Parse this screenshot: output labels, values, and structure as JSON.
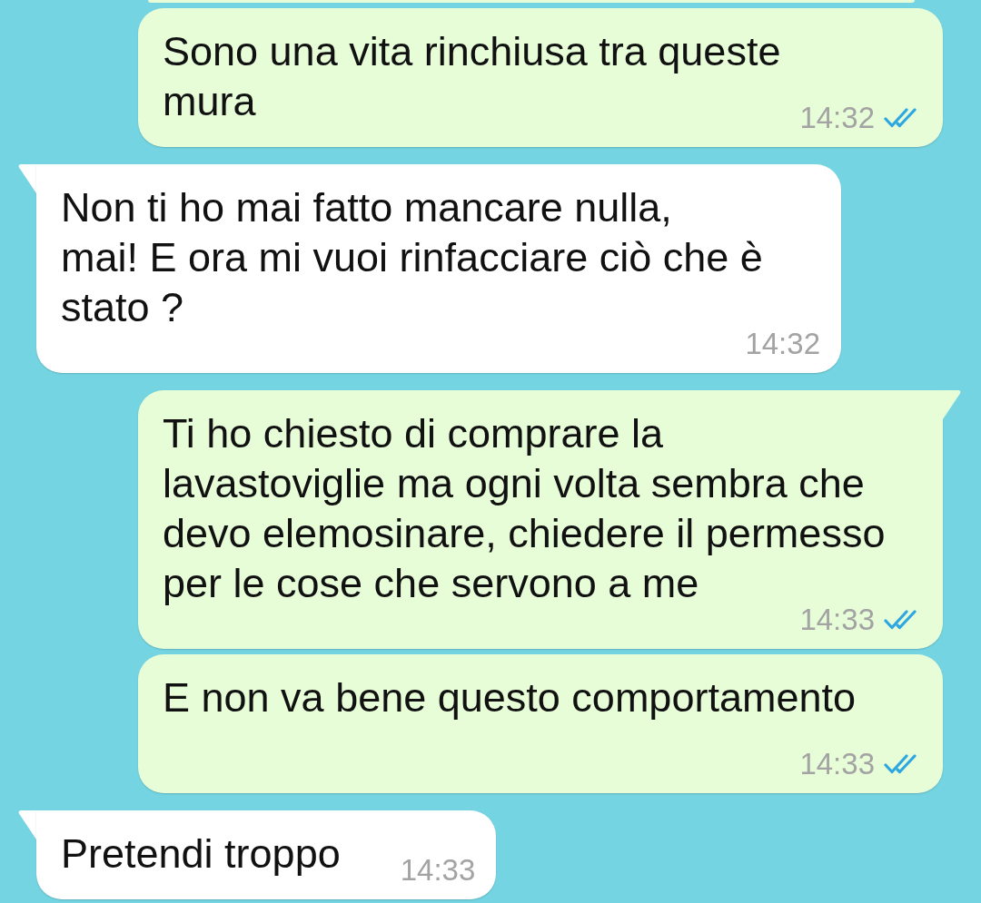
{
  "messages": [
    {
      "kind": "outgoing",
      "partial": true
    },
    {
      "kind": "outgoing",
      "partial": false,
      "tail": false,
      "text": "Sono una vita rinchiusa tra queste\nmura",
      "time": "14:32",
      "read": true
    },
    {
      "kind": "incoming",
      "partial": false,
      "tail": true,
      "text": "Non ti ho mai fatto mancare nulla,\nmai! E ora mi vuoi rinfacciare ciò che è\nstato ?",
      "time": "14:32"
    },
    {
      "kind": "outgoing",
      "partial": false,
      "tail": true,
      "text": "Ti ho chiesto di comprare la\nlavastoviglie ma ogni volta sembra che\ndevo elemosinare, chiedere il permesso\nper le cose che servono a me",
      "time": "14:33",
      "read": true
    },
    {
      "kind": "outgoing",
      "partial": false,
      "tail": false,
      "text": "E non va bene questo comportamento",
      "time": "14:33",
      "read": true
    },
    {
      "kind": "incoming",
      "partial": false,
      "tail": true,
      "text": "Pretendi troppo",
      "time": "14:33"
    }
  ]
}
